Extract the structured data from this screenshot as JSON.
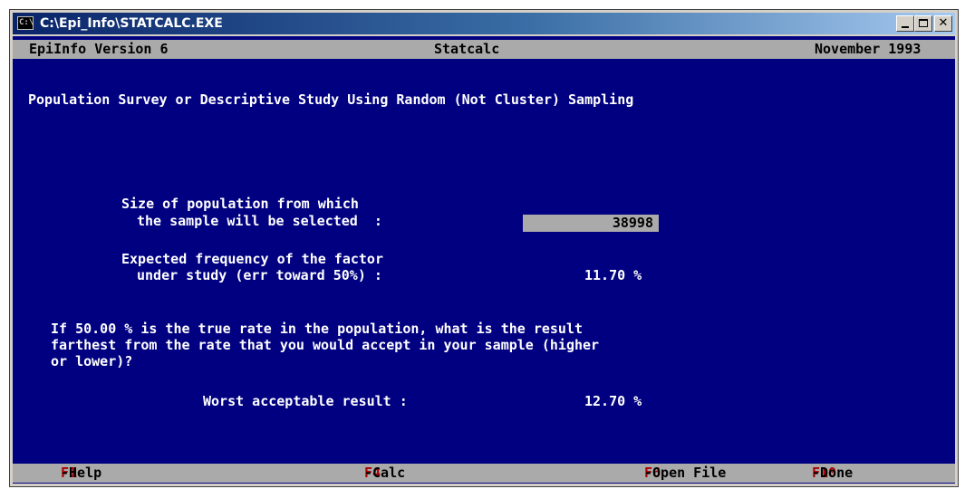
{
  "window": {
    "title": "C:\\Epi_Info\\STATCALC.EXE",
    "icon_name": "console-icon",
    "controls": [
      "minimize",
      "maximize",
      "close"
    ]
  },
  "header": {
    "version": "EpiInfo Version 6",
    "program": "Statcalc",
    "date": "November 1993"
  },
  "main": {
    "heading": "Population Survey or Descriptive Study Using Random (Not Cluster) Sampling",
    "population_label_line1": "Size of population from which",
    "population_label_line2": "the sample will be selected  :",
    "population_value": "38998",
    "frequency_label_line1": "Expected frequency of the factor",
    "frequency_label_line2": "under study (err toward 50%) :",
    "frequency_value": "11.70 %",
    "question_line1": "If 50.00 % is the true rate in the population, what is the result",
    "question_line2": "farthest from the rate that you would accept in your sample (higher",
    "question_line3": "or lower)?",
    "worst_label": "Worst acceptable result :",
    "worst_value": "12.70 %"
  },
  "footer": {
    "help_key": "F1",
    "help_label": "-Help",
    "calc_key": "F4",
    "calc_label": "-Calc",
    "open_key": "F6",
    "open_label": "-Open File",
    "done_key": "F10",
    "done_label": "-Done"
  },
  "colors": {
    "screen_background": "#000080",
    "bar_background": "#aaaaaa",
    "function_key": "#aa0000",
    "text": "#ffffff"
  }
}
